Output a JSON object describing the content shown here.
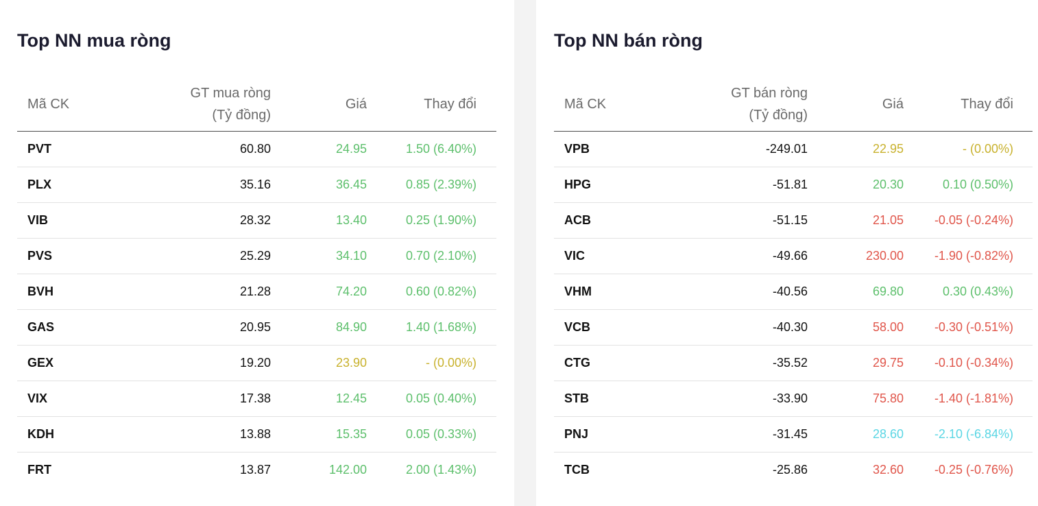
{
  "colors": {
    "up": "#5cbf6b",
    "ref": "#c8b12c",
    "down": "#e0554a",
    "floor": "#5ad6e4"
  },
  "buy": {
    "title": "Top NN mua ròng",
    "headers": {
      "symbol": "Mã CK",
      "value_line1": "GT mua ròng",
      "value_line2": "(Tỷ đồng)",
      "price": "Giá",
      "change": "Thay đổi"
    },
    "rows": [
      {
        "symbol": "PVT",
        "value": "60.80",
        "price": "24.95",
        "change": "1.50 (6.40%)",
        "status": "up"
      },
      {
        "symbol": "PLX",
        "value": "35.16",
        "price": "36.45",
        "change": "0.85 (2.39%)",
        "status": "up"
      },
      {
        "symbol": "VIB",
        "value": "28.32",
        "price": "13.40",
        "change": "0.25 (1.90%)",
        "status": "up"
      },
      {
        "symbol": "PVS",
        "value": "25.29",
        "price": "34.10",
        "change": "0.70 (2.10%)",
        "status": "up"
      },
      {
        "symbol": "BVH",
        "value": "21.28",
        "price": "74.20",
        "change": "0.60 (0.82%)",
        "status": "up"
      },
      {
        "symbol": "GAS",
        "value": "20.95",
        "price": "84.90",
        "change": "1.40 (1.68%)",
        "status": "up"
      },
      {
        "symbol": "GEX",
        "value": "19.20",
        "price": "23.90",
        "change": "- (0.00%)",
        "status": "ref"
      },
      {
        "symbol": "VIX",
        "value": "17.38",
        "price": "12.45",
        "change": "0.05 (0.40%)",
        "status": "up"
      },
      {
        "symbol": "KDH",
        "value": "13.88",
        "price": "15.35",
        "change": "0.05 (0.33%)",
        "status": "up"
      },
      {
        "symbol": "FRT",
        "value": "13.87",
        "price": "142.00",
        "change": "2.00 (1.43%)",
        "status": "up"
      }
    ]
  },
  "sell": {
    "title": "Top NN bán ròng",
    "headers": {
      "symbol": "Mã CK",
      "value_line1": "GT bán ròng",
      "value_line2": "(Tỷ đồng)",
      "price": "Giá",
      "change": "Thay đổi"
    },
    "rows": [
      {
        "symbol": "VPB",
        "value": "-249.01",
        "price": "22.95",
        "change": "- (0.00%)",
        "status": "ref"
      },
      {
        "symbol": "HPG",
        "value": "-51.81",
        "price": "20.30",
        "change": "0.10 (0.50%)",
        "status": "up"
      },
      {
        "symbol": "ACB",
        "value": "-51.15",
        "price": "21.05",
        "change": "-0.05 (-0.24%)",
        "status": "down"
      },
      {
        "symbol": "VIC",
        "value": "-49.66",
        "price": "230.00",
        "change": "-1.90 (-0.82%)",
        "status": "down"
      },
      {
        "symbol": "VHM",
        "value": "-40.56",
        "price": "69.80",
        "change": "0.30 (0.43%)",
        "status": "up"
      },
      {
        "symbol": "VCB",
        "value": "-40.30",
        "price": "58.00",
        "change": "-0.30 (-0.51%)",
        "status": "down"
      },
      {
        "symbol": "CTG",
        "value": "-35.52",
        "price": "29.75",
        "change": "-0.10 (-0.34%)",
        "status": "down"
      },
      {
        "symbol": "STB",
        "value": "-33.90",
        "price": "75.80",
        "change": "-1.40 (-1.81%)",
        "status": "down"
      },
      {
        "symbol": "PNJ",
        "value": "-31.45",
        "price": "28.60",
        "change": "-2.10 (-6.84%)",
        "status": "floor"
      },
      {
        "symbol": "TCB",
        "value": "-25.86",
        "price": "32.60",
        "change": "-0.25 (-0.76%)",
        "status": "down"
      }
    ]
  }
}
